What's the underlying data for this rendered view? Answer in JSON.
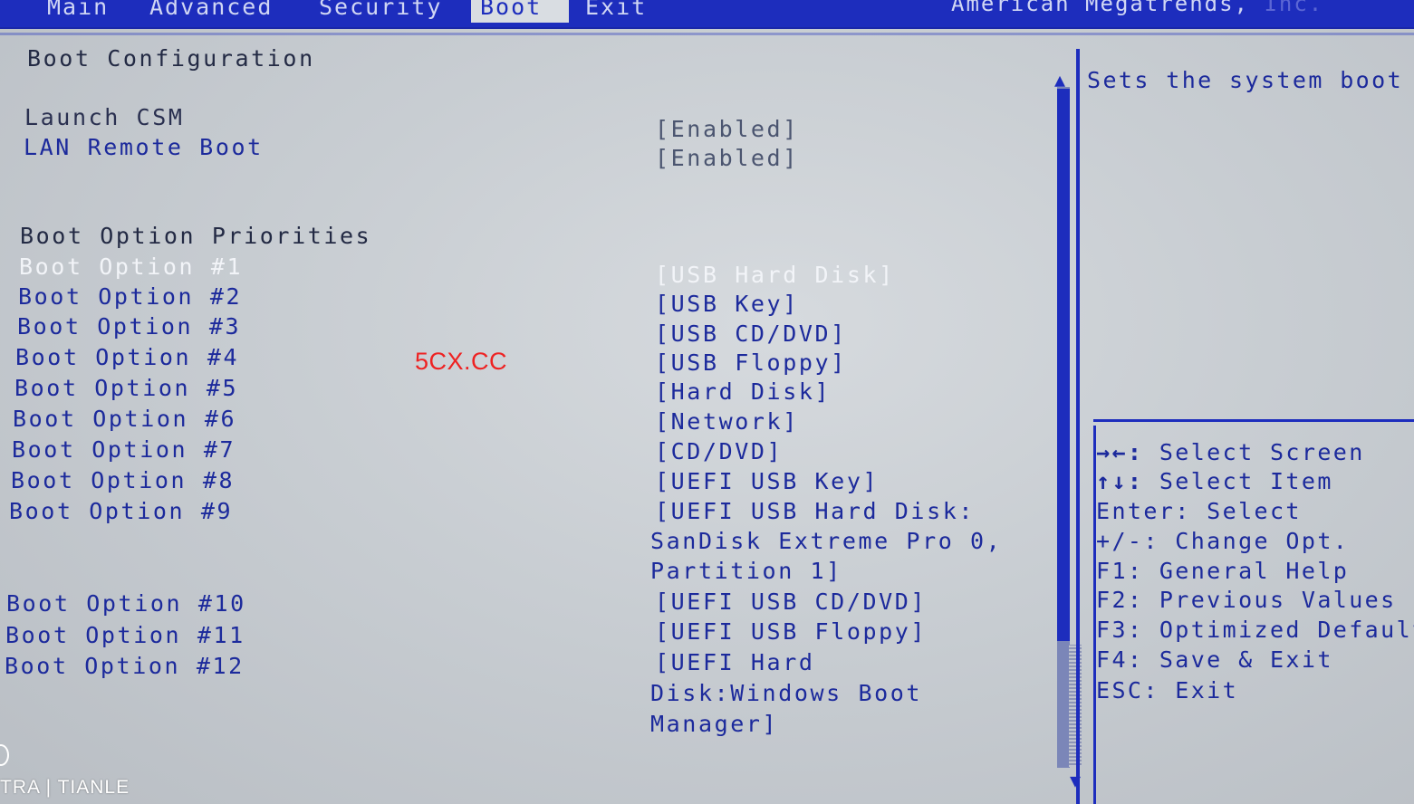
{
  "menu": {
    "tabs": [
      {
        "label": "Main"
      },
      {
        "label": "Advanced"
      },
      {
        "label": "Security"
      },
      {
        "label": "Boot"
      },
      {
        "label": "Exit"
      }
    ],
    "active_tab": "Boot",
    "copyright_text": "American Megatrends,",
    "copyright_suffix": "Inc."
  },
  "main": {
    "section_title": "Boot Configuration",
    "settings": [
      {
        "label": "Launch CSM",
        "value": "[Enabled]"
      },
      {
        "label": "LAN Remote Boot",
        "value": "[Enabled]"
      }
    ],
    "priorities_title": "Boot Option Priorities",
    "boot_options": [
      {
        "label": "Boot Option #1",
        "value": "[USB Hard Disk]"
      },
      {
        "label": "Boot Option #2",
        "value": "[USB Key]"
      },
      {
        "label": "Boot Option #3",
        "value": "[USB CD/DVD]"
      },
      {
        "label": "Boot Option #4",
        "value": "[USB Floppy]"
      },
      {
        "label": "Boot Option #5",
        "value": "[Hard Disk]"
      },
      {
        "label": "Boot Option #6",
        "value": "[Network]"
      },
      {
        "label": "Boot Option #7",
        "value": "[CD/DVD]"
      },
      {
        "label": "Boot Option #8",
        "value": "[UEFI USB Key]"
      },
      {
        "label": "Boot Option #9",
        "value_lines": [
          "[UEFI USB Hard Disk:",
          "SanDisk Extreme Pro 0,",
          "Partition 1]"
        ]
      },
      {
        "label": "Boot Option #10",
        "value": "[UEFI USB CD/DVD]"
      },
      {
        "label": "Boot Option #11",
        "value": "[UEFI USB Floppy]"
      },
      {
        "label": "Boot Option #12",
        "value_lines": [
          "[UEFI Hard",
          "Disk:Windows Boot",
          "Manager]"
        ]
      }
    ]
  },
  "help": {
    "description": "Sets the system boot order",
    "keys": [
      {
        "key": "→←:",
        "action": "Select Screen"
      },
      {
        "key": "↑↓:",
        "action": "Select Item"
      },
      {
        "key": "Enter:",
        "action": "Select"
      },
      {
        "key": "+/-:",
        "action": "Change Opt."
      },
      {
        "key": "F1:",
        "action": "General Help"
      },
      {
        "key": "F2:",
        "action": "Previous Values"
      },
      {
        "key": "F3:",
        "action": "Optimized Defaults"
      },
      {
        "key": "F4:",
        "action": "Save & Exit"
      },
      {
        "key": "ESC:",
        "action": "Exit"
      }
    ]
  },
  "overlay": {
    "watermark": "5CX.CC",
    "camera_mark": "TRA | TIANLE"
  },
  "scrollbar": {
    "up_arrow": "▲",
    "down_arrow": "▼"
  },
  "colors": {
    "bios_blue": "#1d2dbd",
    "screen_grey": "#c9ced3",
    "highlight": "#f2f4f8",
    "watermark_red": "#ee2222"
  }
}
